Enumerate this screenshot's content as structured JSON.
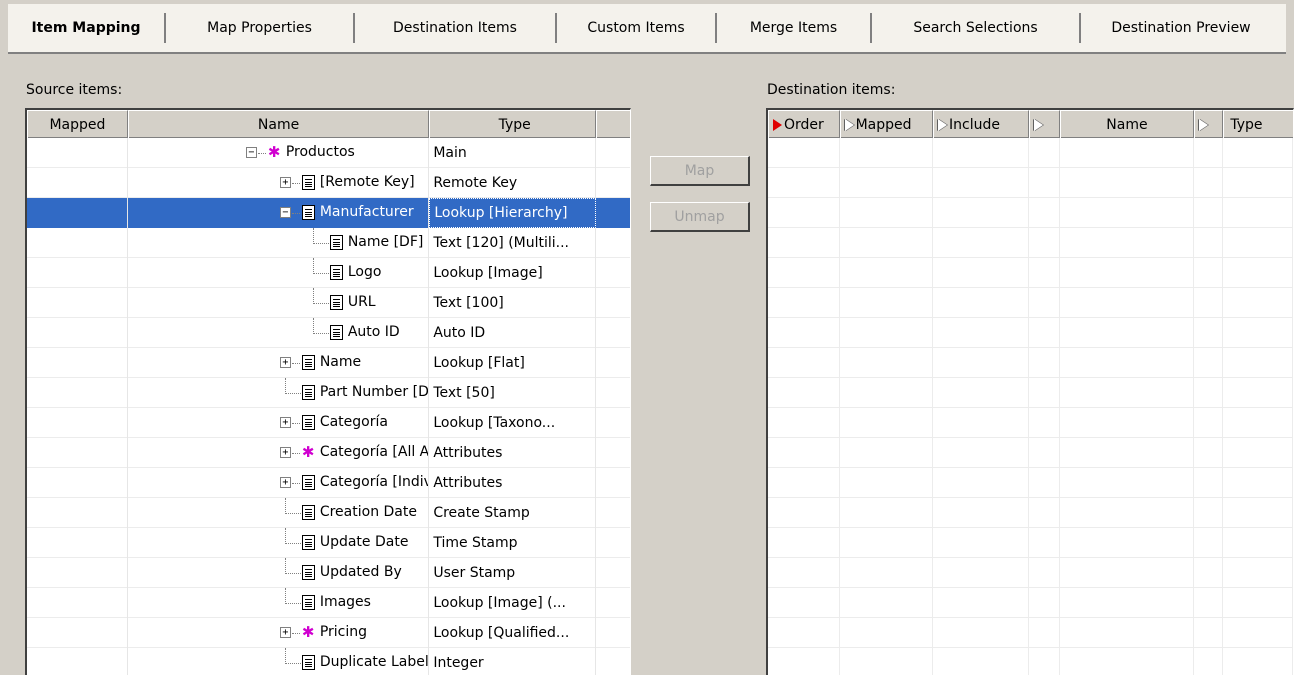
{
  "tabs": [
    {
      "label": "Item Mapping",
      "active": true
    },
    {
      "label": "Map Properties"
    },
    {
      "label": "Destination Items"
    },
    {
      "label": "Custom Items"
    },
    {
      "label": "Merge Items"
    },
    {
      "label": "Search Selections"
    },
    {
      "label": "Destination Preview"
    }
  ],
  "source": {
    "label": "Source items:",
    "columns": {
      "mapped": "Mapped",
      "name": "Name",
      "type": "Type"
    },
    "rows": [
      {
        "name": "Productos",
        "type": "Main",
        "icon": "star-icon",
        "expander": "minus"
      },
      {
        "name": "[Remote Key]",
        "type": "Remote Key",
        "icon": "document-icon",
        "expander": "plus"
      },
      {
        "name": "Manufacturer",
        "type": "Lookup [Hierarchy]",
        "icon": "document-icon",
        "expander": "minus",
        "selected": true
      },
      {
        "name": "Name [DF]",
        "type": "Text [120] (Multili...",
        "icon": "document-icon"
      },
      {
        "name": "Logo",
        "type": "Lookup [Image]",
        "icon": "document-icon"
      },
      {
        "name": "URL",
        "type": "Text [100]",
        "icon": "document-icon"
      },
      {
        "name": "Auto ID",
        "type": "Auto ID",
        "icon": "document-icon"
      },
      {
        "name": "Name",
        "type": "Lookup [Flat]",
        "icon": "document-icon",
        "expander": "plus"
      },
      {
        "name": "Part Number [DF]",
        "type": "Text [50]",
        "icon": "document-icon"
      },
      {
        "name": "Categoría",
        "type": "Lookup [Taxono...",
        "icon": "document-icon",
        "expander": "plus"
      },
      {
        "name": "Categoría [All Attributes]",
        "type": "Attributes",
        "icon": "star-icon",
        "expander": "plus"
      },
      {
        "name": "Categoría [Individual Attr",
        "type": "Attributes",
        "icon": "document-icon",
        "expander": "plus"
      },
      {
        "name": "Creation Date",
        "type": "Create Stamp",
        "icon": "document-icon"
      },
      {
        "name": "Update Date",
        "type": "Time Stamp",
        "icon": "document-icon"
      },
      {
        "name": "Updated By",
        "type": "User Stamp",
        "icon": "document-icon"
      },
      {
        "name": "Images",
        "type": "Lookup [Image] (...",
        "icon": "document-icon"
      },
      {
        "name": "Pricing",
        "type": "Lookup [Qualified...",
        "icon": "star-icon",
        "expander": "plus"
      },
      {
        "name": "Duplicate Label [Manufac",
        "type": "Integer",
        "icon": "document-icon"
      }
    ]
  },
  "buttons": {
    "map": "Map",
    "unmap": "Unmap"
  },
  "destination": {
    "label": "Destination items:",
    "columns": {
      "order": "Order",
      "mapped": "Mapped",
      "include": "Include",
      "name": "Name",
      "type": "Type"
    }
  },
  "colors": {
    "selection": "#316ac5",
    "background": "#d4d0c8",
    "star": "#d000d0"
  }
}
